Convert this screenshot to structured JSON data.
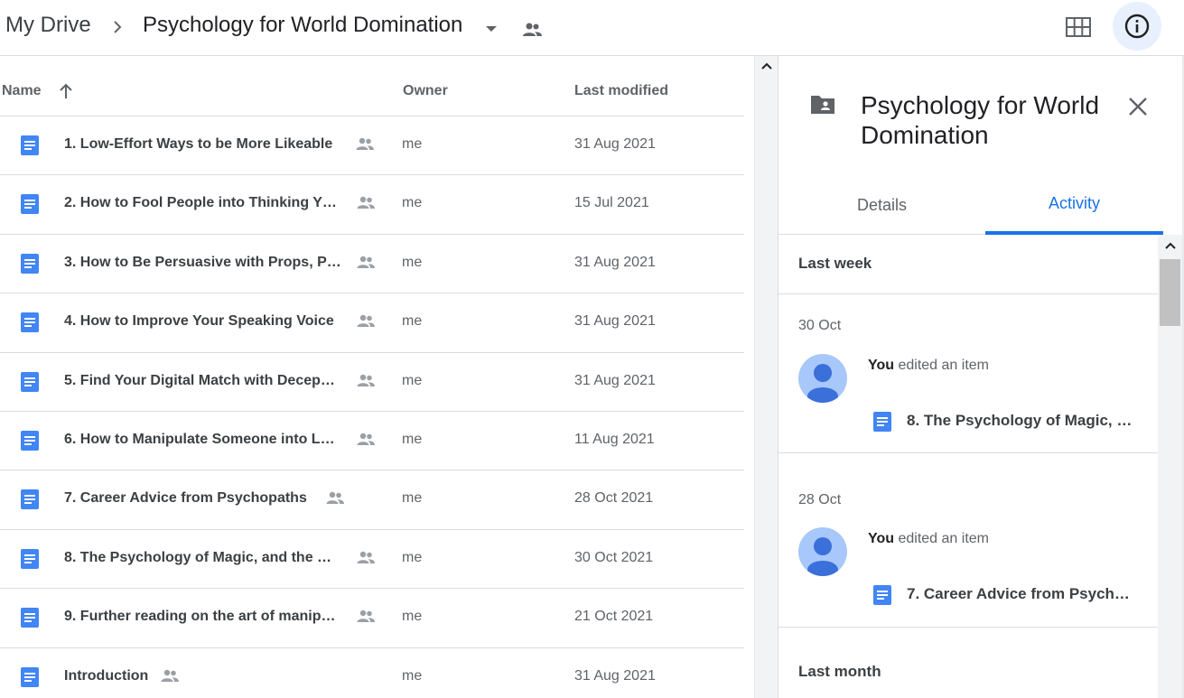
{
  "breadcrumb": {
    "root": "My Drive",
    "current": "Psychology for World Domination"
  },
  "list": {
    "columns": {
      "name": "Name",
      "owner": "Owner",
      "last_modified": "Last modified"
    },
    "files": [
      {
        "name": "1. Low-Effort Ways to be More Likeable",
        "owner": "me",
        "modified": "31 Aug 2021"
      },
      {
        "name": "2. How to Fool People into Thinking Y…",
        "owner": "me",
        "modified": "15 Jul 2021"
      },
      {
        "name": "3. How to Be Persuasive with Props, P…",
        "owner": "me",
        "modified": "31 Aug 2021"
      },
      {
        "name": "4. How to Improve Your Speaking Voice",
        "owner": "me",
        "modified": "31 Aug 2021"
      },
      {
        "name": "5. Find Your Digital Match with Decep…",
        "owner": "me",
        "modified": "31 Aug 2021"
      },
      {
        "name": "6. How to Manipulate Someone into L…",
        "owner": "me",
        "modified": "11 Aug 2021"
      },
      {
        "name": "7. Career Advice from Psychopaths",
        "owner": "me",
        "modified": "28 Oct 2021"
      },
      {
        "name": "8. The Psychology of Magic, and the …",
        "owner": "me",
        "modified": "30 Oct 2021"
      },
      {
        "name": "9. Further reading on the art of manip…",
        "owner": "me",
        "modified": "21 Oct 2021"
      },
      {
        "name": "Introduction",
        "owner": "me",
        "modified": "31 Aug 2021"
      }
    ]
  },
  "panel": {
    "title": "Psychology for World Domination",
    "tabs": {
      "details": "Details",
      "activity": "Activity"
    },
    "activity": {
      "section_last_week": "Last week",
      "section_last_month": "Last month",
      "entries": [
        {
          "date": "30 Oct",
          "actor": "You",
          "action": " edited an item",
          "item": "8. The Psychology of Magic, …"
        },
        {
          "date": "28 Oct",
          "actor": "You",
          "action": " edited an item",
          "item": "7. Career Advice from Psych…"
        }
      ]
    }
  },
  "colors": {
    "accent": "#1a73e8",
    "doc_blue": "#4285f4",
    "icon_gray": "#5f6368",
    "avatar_bg": "#a8c7fa",
    "avatar_fg": "#3b6fd9"
  }
}
